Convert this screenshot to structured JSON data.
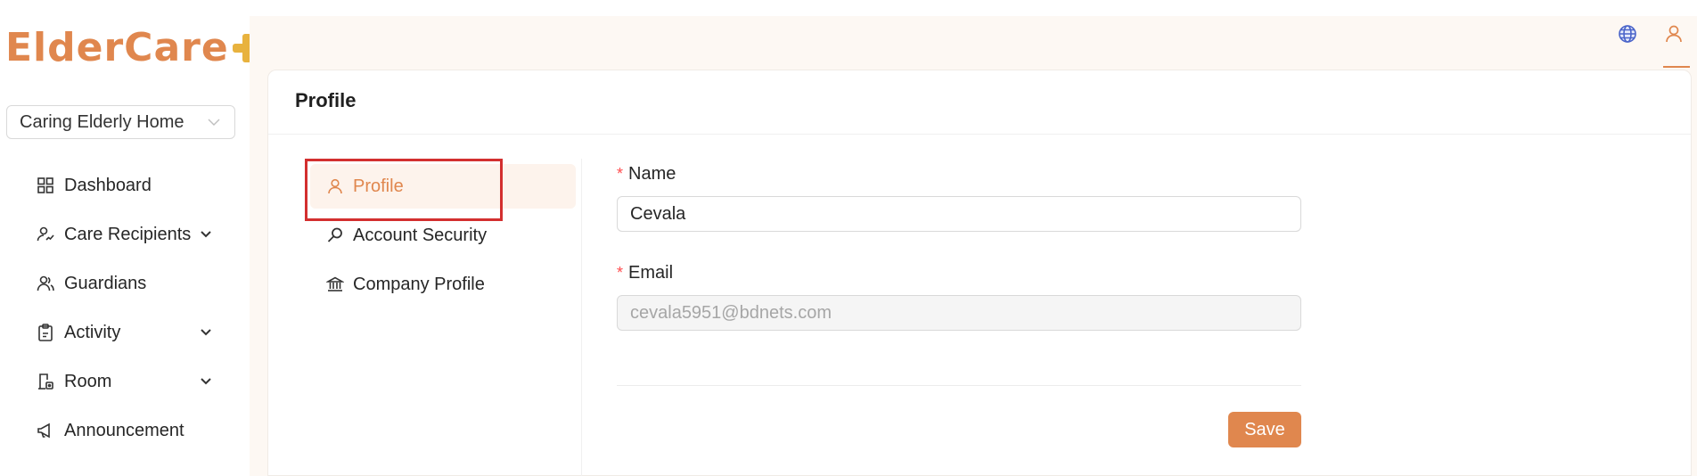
{
  "brand": {
    "logo_text": "ElderCare",
    "accent": "#e0874e",
    "plus_color": "#e8b23e"
  },
  "sidebar": {
    "facility": "Caring Elderly Home",
    "items": [
      {
        "label": "Dashboard",
        "icon": "dashboard-grid-icon",
        "expandable": false
      },
      {
        "label": "Care Recipients",
        "icon": "care-recipients-icon",
        "expandable": true
      },
      {
        "label": "Guardians",
        "icon": "guardians-icon",
        "expandable": false
      },
      {
        "label": "Activity",
        "icon": "activity-clipboard-icon",
        "expandable": true
      },
      {
        "label": "Room",
        "icon": "room-icon",
        "expandable": true
      },
      {
        "label": "Announcement",
        "icon": "megaphone-icon",
        "expandable": false
      }
    ]
  },
  "header": {
    "icons": [
      "globe-icon",
      "user-icon"
    ]
  },
  "page": {
    "title": "Profile"
  },
  "settings_menu": {
    "items": [
      {
        "label": "Profile",
        "icon": "user-icon",
        "active": true
      },
      {
        "label": "Account Security",
        "icon": "key-search-icon",
        "active": false
      },
      {
        "label": "Company Profile",
        "icon": "bank-icon",
        "active": false
      }
    ]
  },
  "form": {
    "name_label": "Name",
    "name_value": "Cevala",
    "email_label": "Email",
    "email_value": "cevala5951@bdnets.com",
    "required_mark": "*",
    "save_label": "Save"
  }
}
